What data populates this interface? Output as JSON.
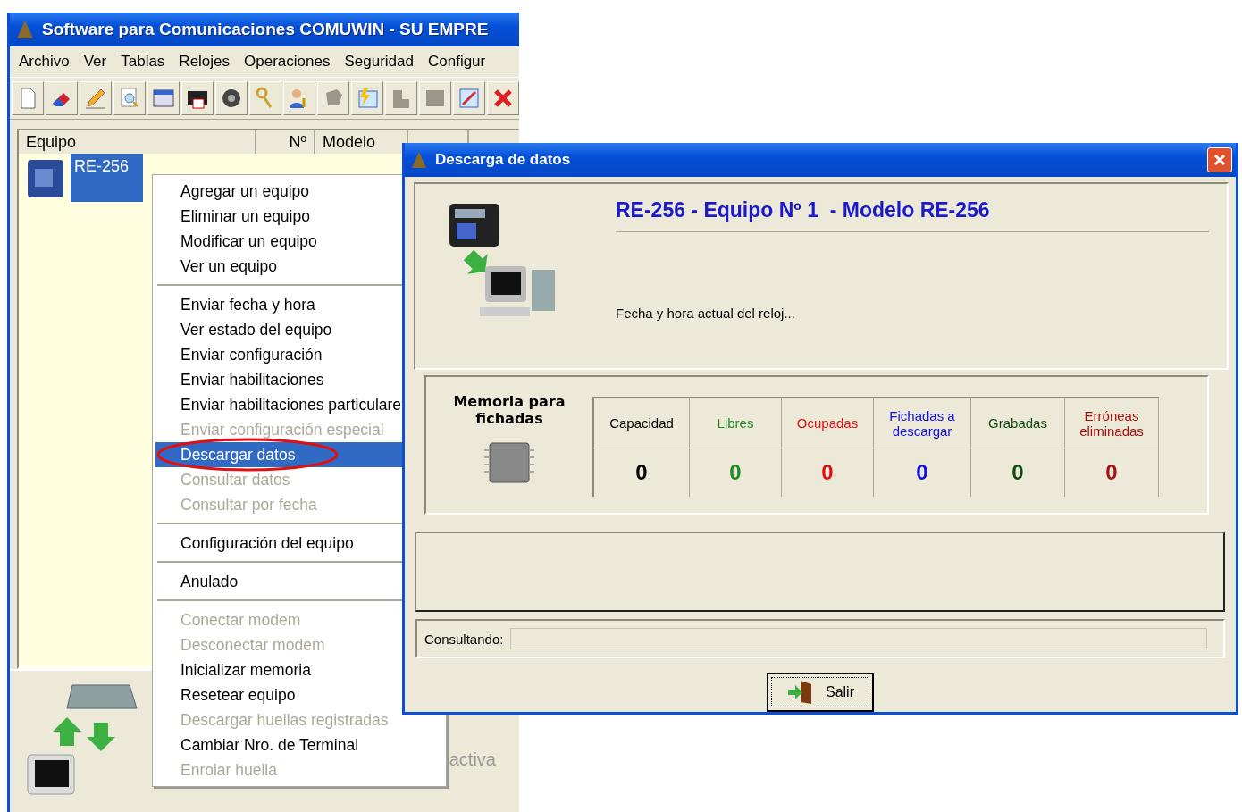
{
  "main_window": {
    "title": "Software para Comunicaciones COMUWIN - SU EMPRE",
    "menu": [
      "Archivo",
      "Ver",
      "Tablas",
      "Relojes",
      "Operaciones",
      "Seguridad",
      "Configur"
    ],
    "table": {
      "columns": [
        "Equipo",
        "Nº",
        "Modelo"
      ],
      "rows": [
        {
          "equipo": "RE-256",
          "selected": true
        }
      ]
    },
    "status_text": "activa"
  },
  "context_menu": {
    "items": [
      {
        "kind": "item",
        "label": "Agregar un equipo",
        "disabled": false,
        "selected": false,
        "annotated": false
      },
      {
        "kind": "item",
        "label": "Eliminar un equipo",
        "disabled": false,
        "selected": false,
        "annotated": false
      },
      {
        "kind": "item",
        "label": "Modificar un equipo",
        "disabled": false,
        "selected": false,
        "annotated": false
      },
      {
        "kind": "item",
        "label": "Ver un equipo",
        "disabled": false,
        "selected": false,
        "annotated": false
      },
      {
        "kind": "separator"
      },
      {
        "kind": "item",
        "label": "Enviar fecha y hora",
        "disabled": false,
        "selected": false,
        "annotated": false
      },
      {
        "kind": "item",
        "label": "Ver estado del equipo",
        "disabled": false,
        "selected": false,
        "annotated": false
      },
      {
        "kind": "item",
        "label": "Enviar configuración",
        "disabled": false,
        "selected": false,
        "annotated": false
      },
      {
        "kind": "item",
        "label": "Enviar habilitaciones",
        "disabled": false,
        "selected": false,
        "annotated": false
      },
      {
        "kind": "item",
        "label": "Enviar habilitaciones particulare",
        "disabled": false,
        "selected": false,
        "annotated": false
      },
      {
        "kind": "item",
        "label": "Enviar configuración especial",
        "disabled": true,
        "selected": false,
        "annotated": false
      },
      {
        "kind": "item",
        "label": "Descargar datos",
        "disabled": false,
        "selected": true,
        "annotated": true
      },
      {
        "kind": "item",
        "label": "Consultar datos",
        "disabled": true,
        "selected": false,
        "annotated": false
      },
      {
        "kind": "item",
        "label": "Consultar por fecha",
        "disabled": true,
        "selected": false,
        "annotated": false
      },
      {
        "kind": "separator"
      },
      {
        "kind": "item",
        "label": "Configuración del equipo",
        "disabled": false,
        "selected": false,
        "annotated": false
      },
      {
        "kind": "separator"
      },
      {
        "kind": "item",
        "label": "Anulado",
        "disabled": false,
        "selected": false,
        "annotated": false
      },
      {
        "kind": "separator"
      },
      {
        "kind": "item",
        "label": "Conectar modem",
        "disabled": true,
        "selected": false,
        "annotated": false
      },
      {
        "kind": "item",
        "label": "Desconectar modem",
        "disabled": true,
        "selected": false,
        "annotated": false
      },
      {
        "kind": "item",
        "label": "Inicializar memoria",
        "disabled": false,
        "selected": false,
        "annotated": false
      },
      {
        "kind": "item",
        "label": "Resetear equipo",
        "disabled": false,
        "selected": false,
        "annotated": false
      },
      {
        "kind": "item",
        "label": "Descargar huellas registradas",
        "disabled": true,
        "selected": false,
        "annotated": false
      },
      {
        "kind": "item",
        "label": "Cambiar Nro. de Terminal",
        "disabled": false,
        "selected": false,
        "annotated": false
      },
      {
        "kind": "item",
        "label": "Enrolar huella",
        "disabled": true,
        "selected": false,
        "annotated": false
      }
    ]
  },
  "dialog": {
    "title": "Descarga de datos",
    "heading": "RE-256 - Equipo Nº 1  - Modelo RE-256",
    "clock_text": "Fecha y hora actual del reloj...",
    "memory": {
      "label": "Memoria para fichadas",
      "stats": [
        {
          "label": "Capacidad",
          "value": "0",
          "color": "#000000"
        },
        {
          "label": "Libres",
          "value": "0",
          "color": "#1f8a1f"
        },
        {
          "label": "Ocupadas",
          "value": "0",
          "color": "#e01010"
        },
        {
          "label": "Fichadas a descargar",
          "value": "0",
          "color": "#1010e0"
        },
        {
          "label": "Grabadas",
          "value": "0",
          "color": "#124a12"
        },
        {
          "label": "Erróneas eliminadas",
          "value": "0",
          "color": "#a81010"
        }
      ]
    },
    "progress": {
      "label": "Consultando:"
    },
    "buttons": [
      "Salir"
    ]
  }
}
